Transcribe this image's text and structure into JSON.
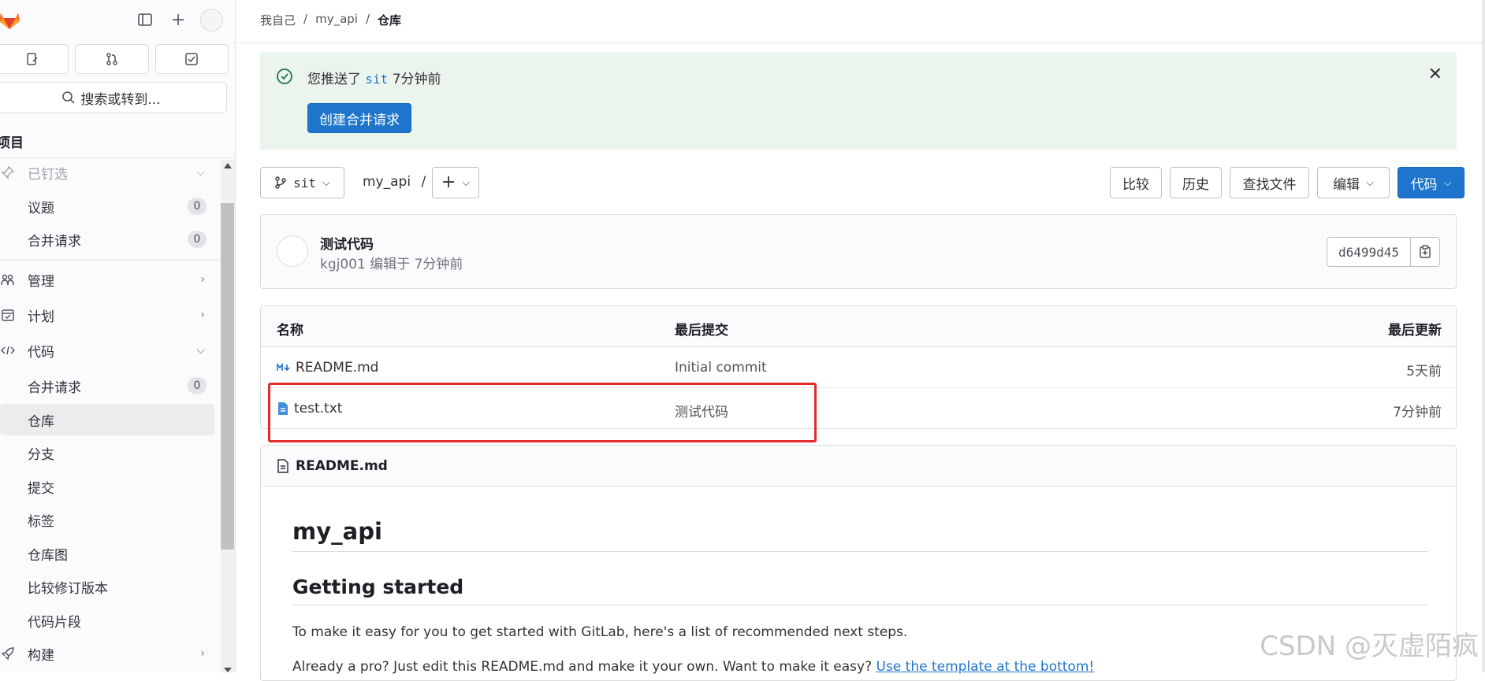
{
  "sidebar": {
    "search_label": "搜索或转到...",
    "section_title": "项目",
    "items": [
      {
        "label": "已钉选",
        "icon": "pin-icon"
      },
      {
        "label": "议题",
        "count": "0"
      },
      {
        "label": "合并请求",
        "count": "0"
      },
      {
        "label": "管理",
        "icon": "users-icon"
      },
      {
        "label": "计划",
        "icon": "calendar-icon"
      },
      {
        "label": "代码",
        "icon": "code-icon"
      },
      {
        "label": "合并请求",
        "count": "0"
      },
      {
        "label": "仓库"
      },
      {
        "label": "分支"
      },
      {
        "label": "提交"
      },
      {
        "label": "标签"
      },
      {
        "label": "仓库图"
      },
      {
        "label": "比较修订版本"
      },
      {
        "label": "代码片段"
      },
      {
        "label": "构建",
        "icon": "rocket-icon"
      }
    ]
  },
  "breadcrumb": {
    "items": [
      "我自己",
      "/",
      "my_api",
      "/",
      "仓库"
    ]
  },
  "alert": {
    "text_prefix": "您推送了",
    "branch": "sit",
    "text_suffix": "7分钟前",
    "button_label": "创建合并请求"
  },
  "toolbar": {
    "branch": "sit",
    "path": "my_api",
    "path_sep": "/",
    "compare": "比较",
    "history": "历史",
    "find_file": "查找文件",
    "edit": "编辑",
    "code": "代码"
  },
  "commit": {
    "title": "测试代码",
    "meta": "kgj001 编辑于 7分钟前",
    "sha": "d6499d45"
  },
  "files": {
    "headers": {
      "name": "名称",
      "last_commit": "最后提交",
      "last_update": "最后更新"
    },
    "rows": [
      {
        "name": "README.md",
        "commit": "Initial commit",
        "date": "5天前",
        "icon": "markdown-icon"
      },
      {
        "name": "test.txt",
        "commit": "测试代码",
        "date": "7分钟前",
        "icon": "text-file-icon"
      }
    ]
  },
  "readme": {
    "header": "README.md",
    "h1": "my_api",
    "h2": "Getting started",
    "p1": "To make it easy for you to get started with GitLab, here's a list of recommended next steps.",
    "p2_text": "Already a pro? Just edit this README.md and make it your own. Want to make it easy?",
    "p2_link": "Use the template at the bottom!"
  },
  "watermark": "CSDN @灭虚陌疯",
  "colors": {
    "accent": "#1f75cb",
    "success_bg": "#ecf4ee",
    "highlight": "#e22b2b"
  }
}
